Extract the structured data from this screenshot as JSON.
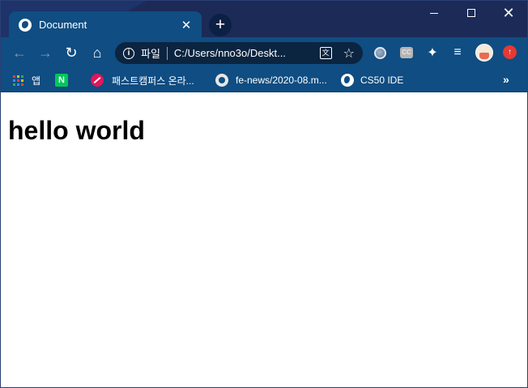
{
  "tab": {
    "title": "Document",
    "close_glyph": "✕"
  },
  "newtab": {
    "glyph": "+"
  },
  "window_controls": {
    "minimize": "minimize",
    "maximize": "maximize",
    "close_glyph": "✕"
  },
  "toolbar": {
    "back_glyph": "←",
    "forward_glyph": "→",
    "reload_glyph": "↻",
    "home_glyph": "⌂"
  },
  "omnibox": {
    "scheme_label": "파일",
    "url": "C:/Users/nno3o/Deskt...",
    "info_glyph": "i",
    "translate_glyph": "文",
    "star_glyph": "☆"
  },
  "extensions": {
    "cc_label": "CC",
    "puzzle_glyph": "✦",
    "playlist_glyph": "≡",
    "update_glyph": "↑"
  },
  "bookmarks": {
    "apps": "앱",
    "naver_logo": "N",
    "fastcampus": "패스트캠퍼스 온라...",
    "github": "fe-news/2020-08.m...",
    "cs50": "CS50 IDE",
    "more_glyph": "»"
  },
  "apps_grid_colors": [
    "#ea4335",
    "#fbbc05",
    "#34a853",
    "#4285f4",
    "#ea4335",
    "#fbbc05",
    "#34a853",
    "#4285f4",
    "#ea4335"
  ],
  "page": {
    "heading": "hello world"
  }
}
